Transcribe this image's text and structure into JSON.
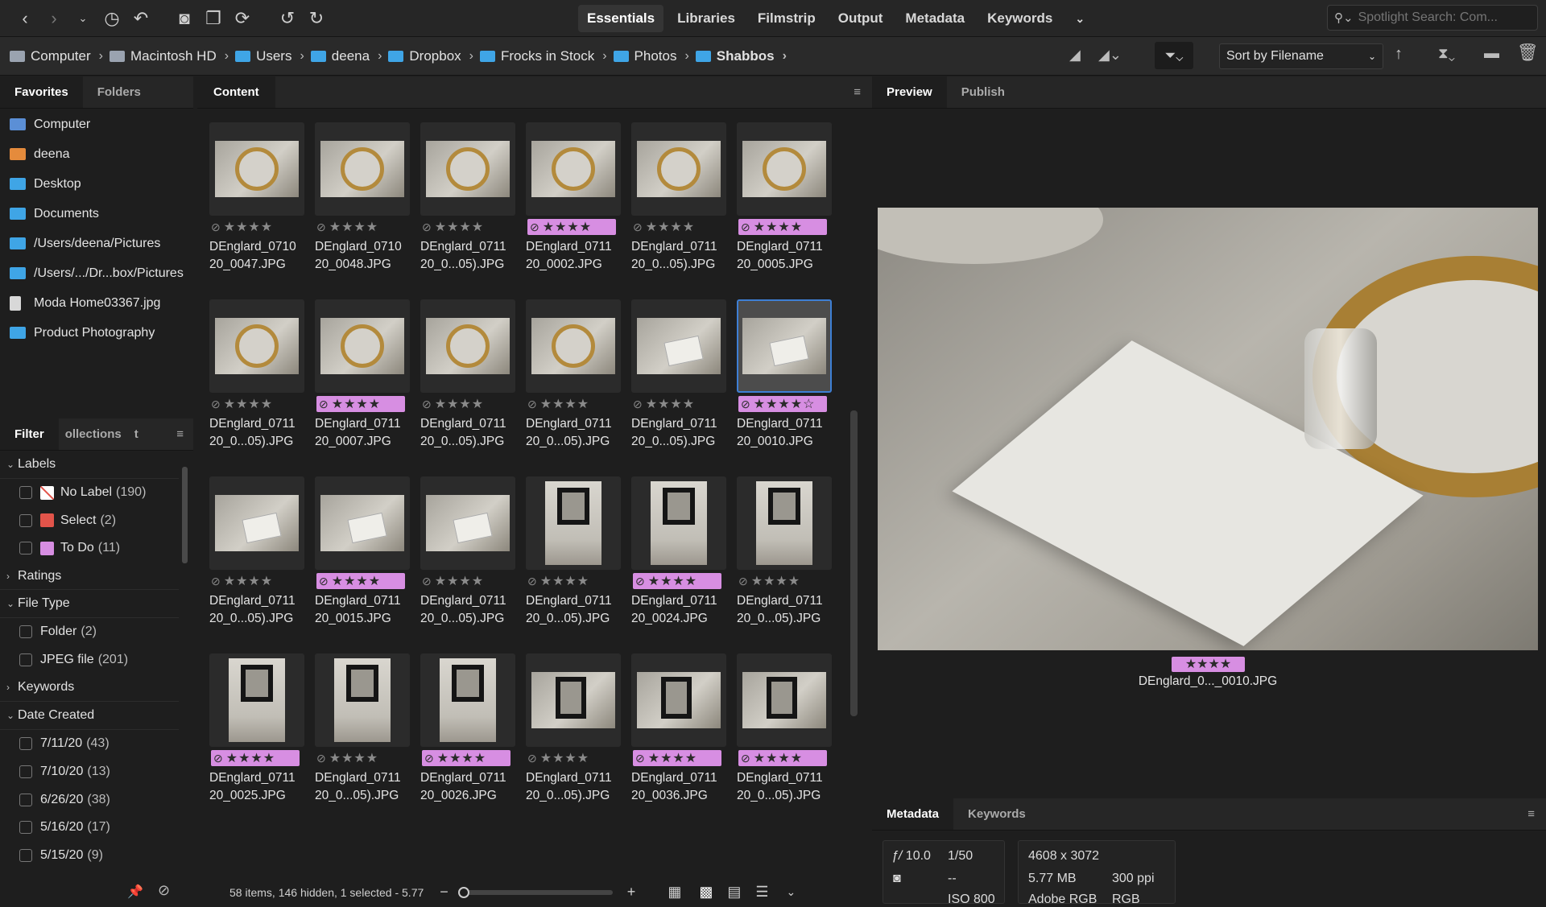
{
  "toolbar": {
    "icons": [
      "back-icon",
      "forward-icon",
      "dropdown-icon",
      "recent-icon",
      "boomerang-icon",
      "camera-icon",
      "copy-icon",
      "refresh-icon",
      "undo-icon",
      "redo-icon"
    ],
    "workspaces": [
      "Essentials",
      "Libraries",
      "Filmstrip",
      "Output",
      "Metadata",
      "Keywords"
    ],
    "active_workspace": "Essentials",
    "search_placeholder": "Spotlight Search: Com..."
  },
  "breadcrumb": [
    "Computer",
    "Macintosh HD",
    "Users",
    "deena",
    "Dropbox",
    "Frocks in Stock",
    "Photos",
    "Shabbos"
  ],
  "sort": {
    "label": "Sort by Filename"
  },
  "left_tabs": {
    "favorites": "Favorites",
    "folders": "Folders"
  },
  "favorites": [
    "Computer",
    "deena",
    "Desktop",
    "Documents",
    "/Users/deena/Pictures",
    "/Users/.../Dr...box/Pictures",
    "Moda Home03367.jpg",
    "Product Photography"
  ],
  "filter_tabs": {
    "filter": "Filter",
    "collections": "ollections",
    "third": "t"
  },
  "filters": {
    "labels_head": "Labels",
    "labels": [
      {
        "name": "No Label",
        "count": "(190)",
        "color": "#ffffff"
      },
      {
        "name": "Select",
        "count": "(2)",
        "color": "#e2544a"
      },
      {
        "name": "To Do",
        "count": "(11)",
        "color": "#d78ee2"
      }
    ],
    "ratings_head": "Ratings",
    "filetype_head": "File Type",
    "filetypes": [
      {
        "name": "Folder",
        "count": "(2)"
      },
      {
        "name": "JPEG file",
        "count": "(201)"
      }
    ],
    "keywords_head": "Keywords",
    "date_head": "Date Created",
    "dates": [
      {
        "name": "7/11/20",
        "count": "(43)"
      },
      {
        "name": "7/10/20",
        "count": "(13)"
      },
      {
        "name": "6/26/20",
        "count": "(38)"
      },
      {
        "name": "5/16/20",
        "count": "(17)"
      },
      {
        "name": "5/15/20",
        "count": "(9)"
      }
    ]
  },
  "content_tab": "Content",
  "thumbnails": [
    {
      "name1": "DEnglard_0710",
      "name2": "20_0047.JPG",
      "label": "none",
      "kind": "land-plate"
    },
    {
      "name1": "DEnglard_0710",
      "name2": "20_0048.JPG",
      "label": "none",
      "kind": "land-plate"
    },
    {
      "name1": "DEnglard_0711",
      "name2": "20_0...05).JPG",
      "label": "none",
      "kind": "land-plate"
    },
    {
      "name1": "DEnglard_0711",
      "name2": "20_0002.JPG",
      "label": "todo",
      "kind": "land-plate"
    },
    {
      "name1": "DEnglard_0711",
      "name2": "20_0...05).JPG",
      "label": "none",
      "kind": "land-plate"
    },
    {
      "name1": "DEnglard_0711",
      "name2": "20_0005.JPG",
      "label": "todo",
      "kind": "land-plate"
    },
    {
      "name1": "DEnglard_0711",
      "name2": "20_0...05).JPG",
      "label": "none",
      "kind": "land-plate"
    },
    {
      "name1": "DEnglard_0711",
      "name2": "20_0007.JPG",
      "label": "todo",
      "kind": "land-plate"
    },
    {
      "name1": "DEnglard_0711",
      "name2": "20_0...05).JPG",
      "label": "none",
      "kind": "land-plate"
    },
    {
      "name1": "DEnglard_0711",
      "name2": "20_0...05).JPG",
      "label": "none",
      "kind": "land-plate"
    },
    {
      "name1": "DEnglard_0711",
      "name2": "20_0...05).JPG",
      "label": "none",
      "kind": "land-card"
    },
    {
      "name1": "DEnglard_0711",
      "name2": "20_0010.JPG",
      "label": "todo",
      "kind": "land-card",
      "selected": true
    },
    {
      "name1": "DEnglard_0711",
      "name2": "20_0...05).JPG",
      "label": "none",
      "kind": "land-card"
    },
    {
      "name1": "DEnglard_0711",
      "name2": "20_0015.JPG",
      "label": "todo",
      "kind": "land-card"
    },
    {
      "name1": "DEnglard_0711",
      "name2": "20_0...05).JPG",
      "label": "none",
      "kind": "land-card"
    },
    {
      "name1": "DEnglard_0711",
      "name2": "20_0...05).JPG",
      "label": "none",
      "kind": "port"
    },
    {
      "name1": "DEnglard_0711",
      "name2": "20_0024.JPG",
      "label": "todo",
      "kind": "port"
    },
    {
      "name1": "DEnglard_0711",
      "name2": "20_0...05).JPG",
      "label": "none",
      "kind": "port"
    },
    {
      "name1": "DEnglard_0711",
      "name2": "20_0025.JPG",
      "label": "todo",
      "kind": "port"
    },
    {
      "name1": "DEnglard_0711",
      "name2": "20_0...05).JPG",
      "label": "none",
      "kind": "port"
    },
    {
      "name1": "DEnglard_0711",
      "name2": "20_0026.JPG",
      "label": "todo",
      "kind": "port"
    },
    {
      "name1": "DEnglard_0711",
      "name2": "20_0...05).JPG",
      "label": "none",
      "kind": "land-frame"
    },
    {
      "name1": "DEnglard_0711",
      "name2": "20_0036.JPG",
      "label": "todo",
      "kind": "land-frame"
    },
    {
      "name1": "DEnglard_0711",
      "name2": "20_0...05).JPG",
      "label": "todo",
      "kind": "land-frame"
    }
  ],
  "status": {
    "text": "58 items, 146 hidden, 1 selected - 5.77"
  },
  "preview_tabs": {
    "preview": "Preview",
    "publish": "Publish"
  },
  "preview": {
    "stars": "★★★★",
    "filename": "DEnglard_0..._0010.JPG"
  },
  "meta_tabs": {
    "metadata": "Metadata",
    "keywords": "Keywords"
  },
  "metadata": {
    "aperture": "10.0",
    "shutter": "1/50",
    "exposure": "--",
    "iso": "ISO 800",
    "dimensions": "4608 x 3072",
    "size": "5.77 MB",
    "ppi": "300 ppi",
    "colorspace": "Adobe RGB",
    "mode": "RGB"
  },
  "colors": {
    "accent": "#3e7fd4",
    "todo": "#d78ee2",
    "select": "#e2544a",
    "folder": "#3fa5e6"
  }
}
